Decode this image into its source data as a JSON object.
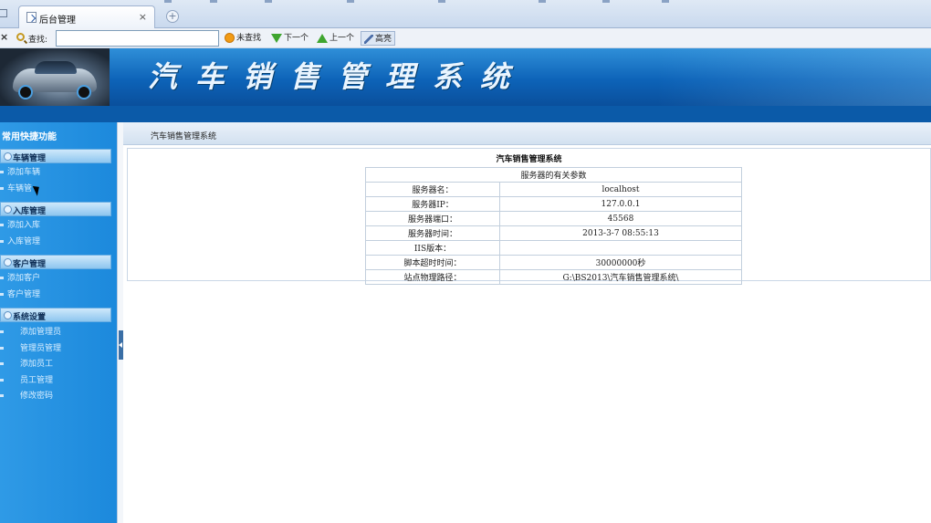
{
  "browser": {
    "tab_title": "后台管理",
    "tab_close": "×",
    "new_tab": "+"
  },
  "findbar": {
    "close": "×",
    "label": "查找:",
    "query": "",
    "not_found": "未查找",
    "next": "下一个",
    "prev": "上一个",
    "highlight": "高亮"
  },
  "header": {
    "title": "汽车销售管理系统"
  },
  "sidebar": {
    "quick_title": "常用快捷功能",
    "groups": [
      {
        "label": "车辆管理",
        "items": [
          "添加车辆",
          "车辆管"
        ]
      },
      {
        "label": "入库管理",
        "items": [
          "添加入库",
          "入库管理"
        ]
      },
      {
        "label": "客户管理",
        "items": [
          "添加客户",
          "客户管理"
        ]
      },
      {
        "label": "系统设置",
        "items": [
          "添加管理员",
          "管理员管理",
          "添加员工",
          "员工管理",
          "修改密码"
        ]
      }
    ]
  },
  "main": {
    "breadcrumb": "汽车销售管理系统",
    "panel_title": "汽车销售管理系统",
    "table_caption": "服务器的有关参数",
    "rows": [
      {
        "key": "服务器名：",
        "value": "localhost"
      },
      {
        "key": "服务器IP：",
        "value": "127.0.0.1"
      },
      {
        "key": "服务器端口：",
        "value": "45568"
      },
      {
        "key": "服务器时间：",
        "value": "2013-3-7 08:55:13"
      },
      {
        "key": "IIS版本：",
        "value": ""
      },
      {
        "key": "脚本超时时间：",
        "value": "30000000秒"
      },
      {
        "key": "站点物理路径：",
        "value": "G:\\BS2013\\汽车销售管理系统\\"
      }
    ]
  },
  "colors": {
    "banner": "#0d63b8",
    "sidebar": "#1c89dc",
    "group_header": "#8ec6ef"
  }
}
